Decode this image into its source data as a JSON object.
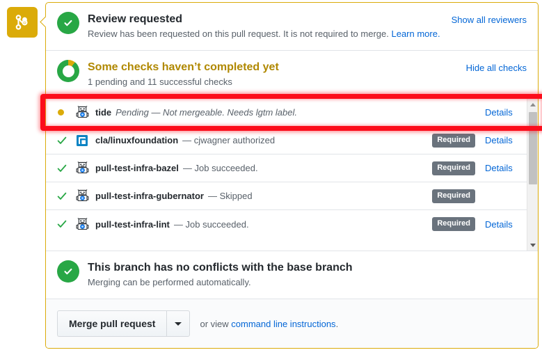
{
  "timeline": {
    "icon": "git-merge-icon",
    "color": "#dbab09"
  },
  "review_section": {
    "icon": "check-circle-icon",
    "title": "Review requested",
    "description_before": "Review has been requested on this pull request. It is not required to merge.",
    "description_link": "Learn more.",
    "action_label": "Show all reviewers"
  },
  "checks_section": {
    "icon": "pending-donut-icon",
    "title": "Some checks haven’t completed yet",
    "subtitle": "1 pending and 11 successful checks",
    "action_label": "Hide all checks",
    "rows": [
      {
        "state": "pending",
        "state_icon": "yellow-dot-icon",
        "avatar": "bot-avatar-icon",
        "name": "tide",
        "separator": "",
        "description": "Pending — Not mergeable. Needs lgtm label.",
        "italic": true,
        "required": false,
        "required_label": "",
        "details_label": "Details"
      },
      {
        "state": "success",
        "state_icon": "check-icon",
        "avatar": "linuxfoundation-logo-icon",
        "name": "cla/linuxfoundation",
        "separator": "—",
        "description": "— cjwagner authorized",
        "italic": false,
        "required": true,
        "required_label": "Required",
        "details_label": "Details"
      },
      {
        "state": "success",
        "state_icon": "check-icon",
        "avatar": "bot-avatar-icon",
        "name": "pull-test-infra-bazel",
        "separator": "—",
        "description": "— Job succeeded.",
        "italic": false,
        "required": true,
        "required_label": "Required",
        "details_label": "Details"
      },
      {
        "state": "success",
        "state_icon": "check-icon",
        "avatar": "bot-avatar-icon",
        "name": "pull-test-infra-gubernator",
        "separator": "—",
        "description": "— Skipped",
        "italic": false,
        "required": true,
        "required_label": "Required",
        "details_label": ""
      },
      {
        "state": "success",
        "state_icon": "check-icon",
        "avatar": "bot-avatar-icon",
        "name": "pull-test-infra-lint",
        "separator": "—",
        "description": "— Job succeeded.",
        "italic": false,
        "required": true,
        "required_label": "Required",
        "details_label": "Details"
      }
    ],
    "scrollbar": {
      "up_arrow": "scroll-up-arrow-icon",
      "down_arrow": "scroll-down-arrow-icon"
    }
  },
  "conflicts_section": {
    "icon": "check-circle-icon",
    "title": "This branch has no conflicts with the base branch",
    "subtitle": "Merging can be performed automatically."
  },
  "merge_footer": {
    "merge_button_label": "Merge pull request",
    "dropdown_icon": "chevron-down-icon",
    "note_prefix": "or view ",
    "note_link": "command line instructions",
    "note_suffix": "."
  },
  "annotation": {
    "highlight_color": "#fc0d1b",
    "target": "tide-check-row"
  }
}
